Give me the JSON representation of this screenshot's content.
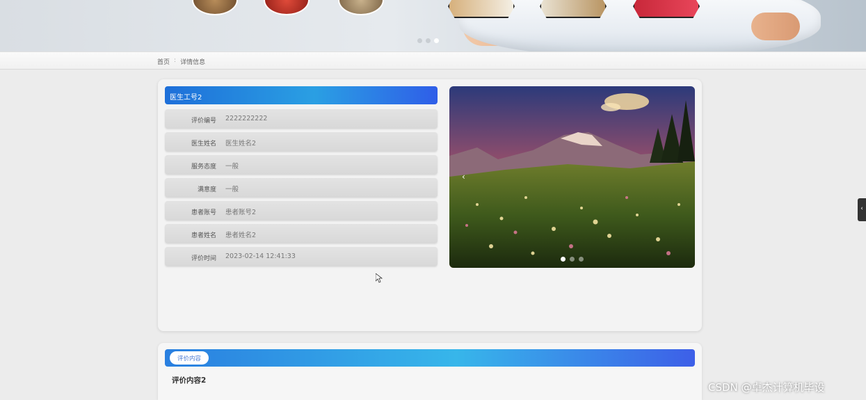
{
  "breadcrumb": {
    "home": "首页",
    "separator": ":",
    "current": "详情信息"
  },
  "detail": {
    "title": "医生工号2",
    "fields": [
      {
        "label": "评价编号",
        "value": "2222222222"
      },
      {
        "label": "医生姓名",
        "value": "医生姓名2"
      },
      {
        "label": "服务态度",
        "value": "一般"
      },
      {
        "label": "满意度",
        "value": "一般"
      },
      {
        "label": "患者账号",
        "value": "患者账号2"
      },
      {
        "label": "患者姓名",
        "value": "患者姓名2"
      },
      {
        "label": "评价时间",
        "value": "2023-02-14 12:41:33"
      }
    ]
  },
  "carousel": {
    "prev_icon": "‹",
    "slide_count": 3,
    "active_slide": 1
  },
  "banner": {
    "slide_count": 3,
    "active_slide": 3
  },
  "content": {
    "tag": "评价内容",
    "text": "评价内容2"
  },
  "side_tab": {
    "icon": "‹"
  },
  "watermark": "CSDN @卓杰计算机毕设",
  "colors": {
    "primary_blue": "#1e6fd9",
    "accent_cyan": "#37b6ea"
  }
}
